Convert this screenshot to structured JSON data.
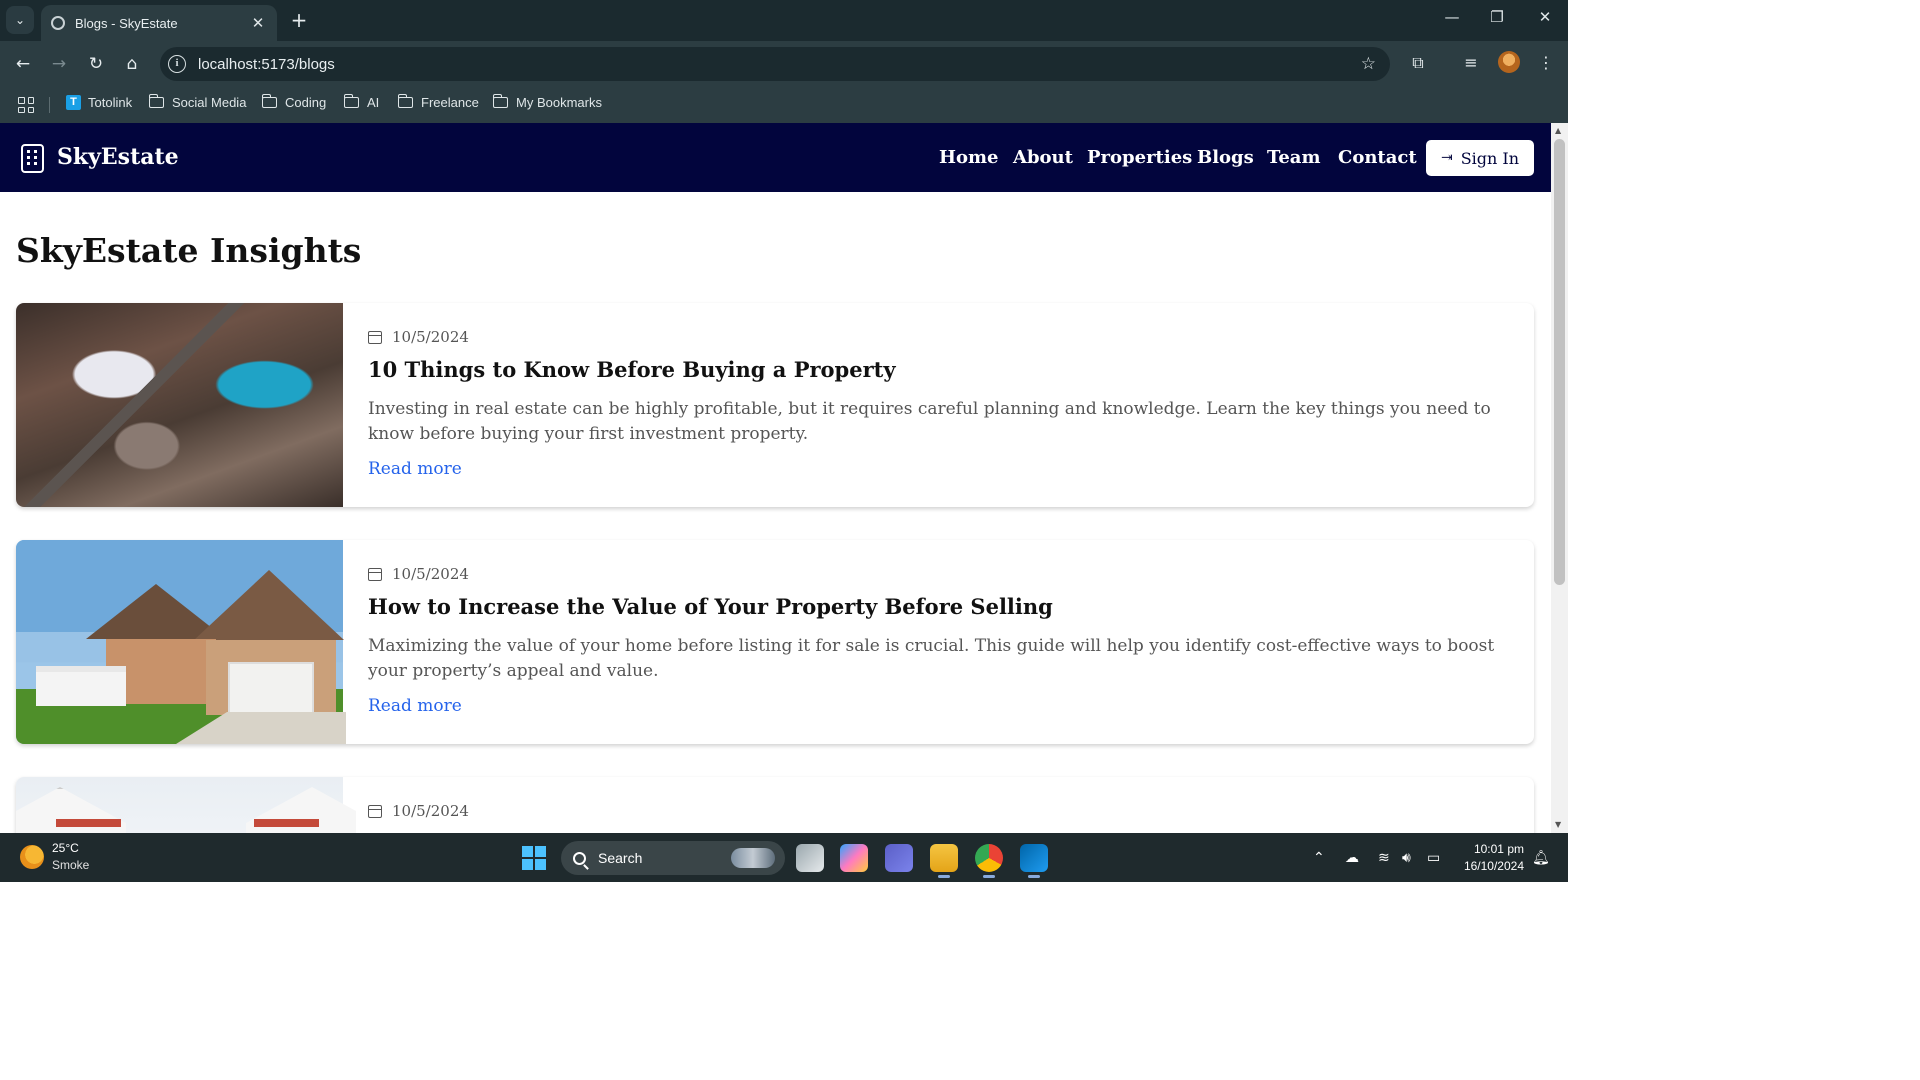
{
  "browser": {
    "tab_title": "Blogs - SkyEstate",
    "url": "localhost:5173/blogs",
    "new_tab_symbol": "+",
    "bookmarks": [
      {
        "label": "Totolink",
        "icon": "totolink-icon"
      },
      {
        "label": "Social Media",
        "icon": "folder-icon"
      },
      {
        "label": "Coding",
        "icon": "folder-icon"
      },
      {
        "label": "AI",
        "icon": "folder-icon"
      },
      {
        "label": "Freelance",
        "icon": "folder-icon"
      },
      {
        "label": "My Bookmarks",
        "icon": "folder-icon"
      }
    ]
  },
  "site": {
    "brand": "SkyEstate",
    "nav": [
      "Home",
      "About",
      "Properties",
      "Blogs",
      "Team",
      "Contact"
    ],
    "sign_in": "Sign In",
    "colors": {
      "nav_bg": "#02053d",
      "link": "#2563eb"
    }
  },
  "page": {
    "title": "SkyEstate Insights",
    "posts": [
      {
        "date": "10/5/2024",
        "title": "10 Things to Know Before Buying a Property",
        "excerpt": "Investing in real estate can be highly profitable, but it requires careful planning and knowledge. Learn the key things you need to know before buying your first investment property.",
        "read_more": "Read more",
        "image": "aerial-rooftops-photo"
      },
      {
        "date": "10/5/2024",
        "title": "How to Increase the Value of Your Property Before Selling",
        "excerpt": "Maximizing the value of your home before listing it for sale is crucial. This guide will help you identify cost-effective ways to boost your property’s appeal and value.",
        "read_more": "Read more",
        "image": "suburban-house-photo"
      },
      {
        "date": "10/5/2024",
        "image": "white-buildings-photo"
      }
    ]
  },
  "taskbar": {
    "temperature": "25°C",
    "condition": "Smoke",
    "search_placeholder": "Search",
    "time": "10:01 pm",
    "date": "16/10/2024"
  }
}
